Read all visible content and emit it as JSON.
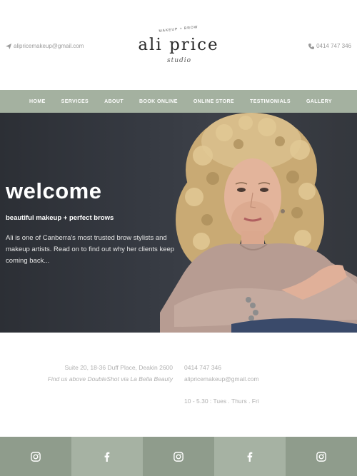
{
  "header": {
    "email": "alipricemakeup@gmail.com",
    "phone": "0414 747 346",
    "logo_tagline": "MAKEUP + BROW",
    "logo_name": "ali price",
    "logo_script": "studio"
  },
  "nav": {
    "items": [
      {
        "label": "HOME"
      },
      {
        "label": "SERVICES"
      },
      {
        "label": "ABOUT"
      },
      {
        "label": "BOOK ONLINE"
      },
      {
        "label": "ONLINE STORE"
      },
      {
        "label": "TESTIMONIALS"
      },
      {
        "label": "GALLERY"
      }
    ]
  },
  "hero": {
    "title": "welcome",
    "subtitle": "beautiful makeup + perfect brows",
    "body": "Ali is one of Canberra's most trusted brow stylists and makeup artists. Read on to find out why her clients keep coming back..."
  },
  "info": {
    "address": "Suite 20, 18-36 Duff Place, Deakin 2600",
    "directions": "Find us above DoubleShot via La Bella Beauty",
    "phone": "0414 747 346",
    "email": "alipricemakeup@gmail.com",
    "hours": "10 - 5.30 : Tues . Thurs . Fri"
  },
  "social": {
    "tiles": [
      {
        "icon": "instagram-icon"
      },
      {
        "icon": "facebook-icon"
      },
      {
        "icon": "instagram-icon"
      },
      {
        "icon": "facebook-icon"
      },
      {
        "icon": "instagram-icon"
      }
    ]
  },
  "colors": {
    "nav_bg": "#a4b1a0",
    "social_dark": "#8f9c8c",
    "social_light": "#a6b2a3",
    "hero_bg": "#34373d"
  }
}
